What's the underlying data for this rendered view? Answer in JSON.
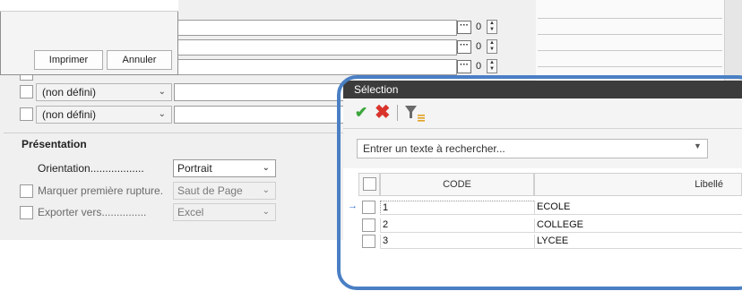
{
  "print_dialog": {
    "print_label": "Imprimer",
    "cancel_label": "Annuler"
  },
  "rows": [
    {
      "number": "0"
    },
    {
      "number": "0"
    },
    {
      "number": "0"
    }
  ],
  "filters": [
    {
      "value": "(non défini)"
    },
    {
      "value": "(non défini)"
    }
  ],
  "presentation": {
    "title": "Présentation",
    "orientation_label": "Orientation..................",
    "orientation_value": "Portrait",
    "rupture_label": "Marquer première rupture.",
    "rupture_value": "Saut de Page",
    "export_label": "Exporter vers...............",
    "export_value": "Excel"
  },
  "selection": {
    "title": "Sélection",
    "search_placeholder": "Entrer un texte à rechercher...",
    "columns": {
      "code": "CODE",
      "libelle": "Libellé"
    },
    "items": [
      {
        "code": "1",
        "libelle": "ECOLE"
      },
      {
        "code": "2",
        "libelle": "COLLEGE"
      },
      {
        "code": "3",
        "libelle": "LYCEE"
      }
    ]
  },
  "colors": {
    "accent_frame": "#4a7fc4",
    "validate_green": "#3aa53a",
    "cancel_red": "#d9342b",
    "title_bar": "#3c3c3c"
  },
  "icons": [
    "ellipsis-icon",
    "spin-icon",
    "chevron-down-icon",
    "check-icon",
    "close-icon",
    "filter-icon",
    "row-pointer-icon"
  ]
}
